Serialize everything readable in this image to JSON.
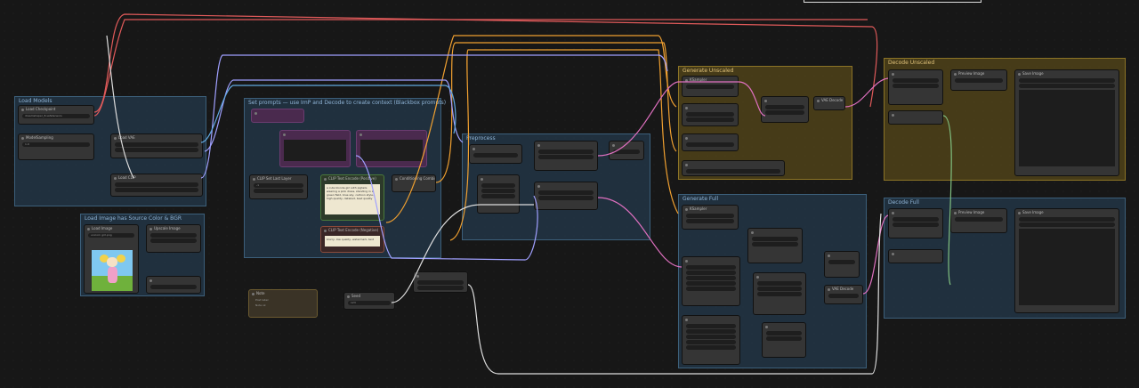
{
  "groups": {
    "load_models": "Load Models",
    "load_image": "Load Image has Source Color & BGR",
    "prompts": "Set prompts — use ImP and Decode to create context (Blackbox prompts)",
    "preprocess": "Preprocess",
    "generate_unscaled": "Generate Unscaled",
    "decode_unscaled": "Decode Unscaled",
    "generate_full": "Generate Full",
    "decode_full": "Decode Full"
  },
  "nodes": {
    "ckpt_loader": {
      "title": "Load Checkpoint",
      "ckpt_name": "dreamshaper_8.safetensors"
    },
    "model_sampling": {
      "title": "ModelSampling",
      "value": "1.0"
    },
    "vae_loader": {
      "title": "Load VAE"
    },
    "clip_loader": {
      "title": "Load CLIP"
    },
    "load_image": {
      "title": "Load Image",
      "image_name": "unicorn girl.png"
    },
    "image_scale": {
      "title": "Upscale Image"
    },
    "note": {
      "title": "Note",
      "line1": "Post label",
      "line2": "Note ok"
    },
    "seed": {
      "title": "Seed",
      "value": "123"
    },
    "positive_prompt": {
      "title": "CLIP Text Encode (Positive)",
      "text": "a cute blonde girl with pigtails wearing a pink dress, standing in a green field, blue sky, cartoon style, high quality, detailed, best quality"
    },
    "negative_prompt": {
      "title": "CLIP Text Encode (Negative)",
      "text": "blurry, low quality, watermark, text"
    },
    "clip_setlast": {
      "title": "CLIP Set Last Layer",
      "value": "-1"
    },
    "conditioning_combine": {
      "title": "Conditioning Combine"
    },
    "ksampler_a": {
      "title": "KSampler"
    },
    "ksampler_b": {
      "title": "KSampler"
    },
    "vae_decode_a": {
      "title": "VAE Decode"
    },
    "vae_decode_b": {
      "title": "VAE Decode"
    },
    "preview_a": {
      "title": "Preview Image"
    },
    "preview_b": {
      "title": "Preview Image"
    },
    "save_a": {
      "title": "Save Image"
    },
    "save_b": {
      "title": "Save Image"
    }
  },
  "colors": {
    "link_red": "#e05a5a",
    "link_orange": "#f0a030",
    "link_pink": "#e070c0",
    "link_lavender": "#a0a0ff",
    "link_green": "#80c080",
    "link_blue": "#60a8e0",
    "link_white": "#dddddd"
  }
}
